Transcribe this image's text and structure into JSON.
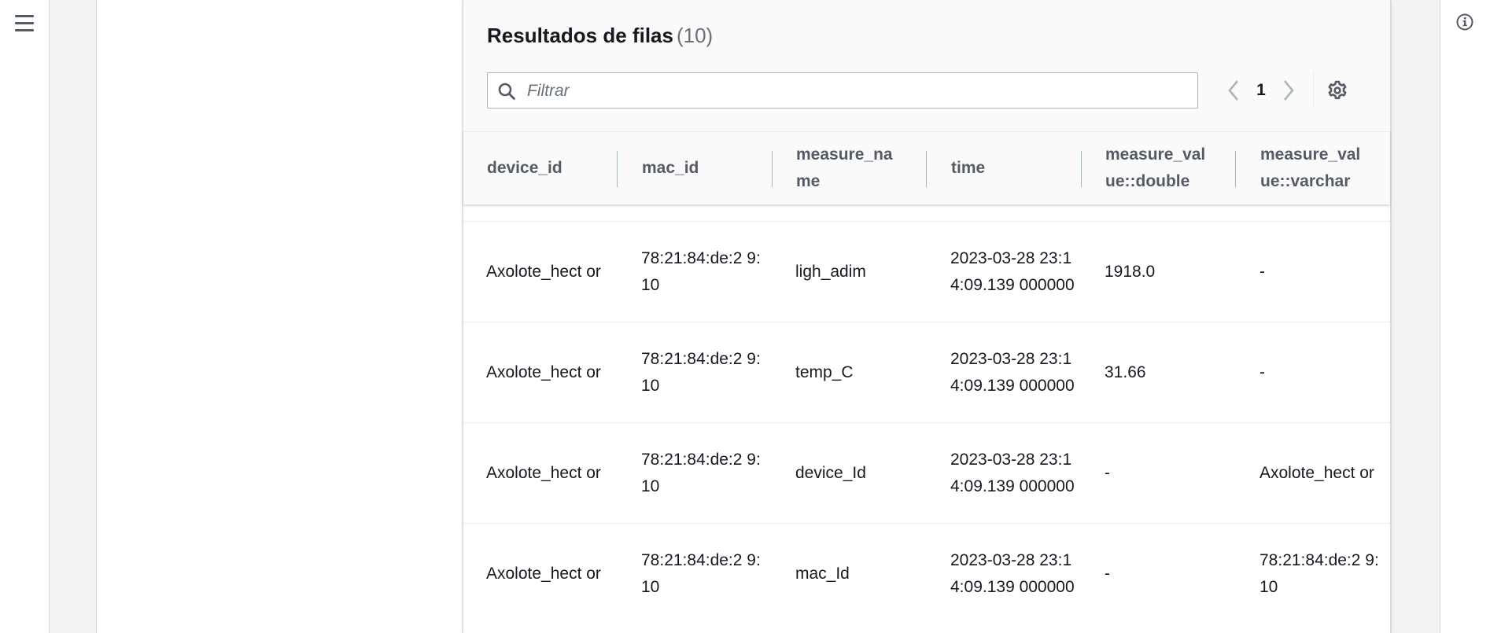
{
  "panel": {
    "title": "Resultados de filas",
    "count": "(10)"
  },
  "filter": {
    "placeholder": "Filtrar",
    "value": ""
  },
  "pagination": {
    "current_page": "1"
  },
  "icons": {
    "menu": "hamburger-menu-icon",
    "info": "info-icon",
    "search": "search-icon",
    "prev": "chevron-left-icon",
    "next": "chevron-right-icon",
    "settings": "gear-icon"
  },
  "columns": [
    "device_id",
    "mac_id",
    "measure_na me",
    "time",
    "measure_val ue::double",
    "measure_val ue::varchar"
  ],
  "rows": [
    [
      "Axolote_hect or",
      "78:21:84:de:2 9:10",
      "ligh_adim",
      "2023-03-28 23:14:09.139 000000",
      "1918.0",
      "-"
    ],
    [
      "Axolote_hect or",
      "78:21:84:de:2 9:10",
      "temp_C",
      "2023-03-28 23:14:09.139 000000",
      "31.66",
      "-"
    ],
    [
      "Axolote_hect or",
      "78:21:84:de:2 9:10",
      "device_Id",
      "2023-03-28 23:14:09.139 000000",
      "-",
      "Axolote_hect or"
    ],
    [
      "Axolote_hect or",
      "78:21:84:de:2 9:10",
      "mac_Id",
      "2023-03-28 23:14:09.139 000000",
      "-",
      "78:21:84:de:2 9:10"
    ]
  ],
  "colors": {
    "header_bg": "#fafafa",
    "content_bg": "#f2f3f3",
    "border": "#eaeded",
    "text": "#16191f",
    "muted": "#545b64"
  }
}
